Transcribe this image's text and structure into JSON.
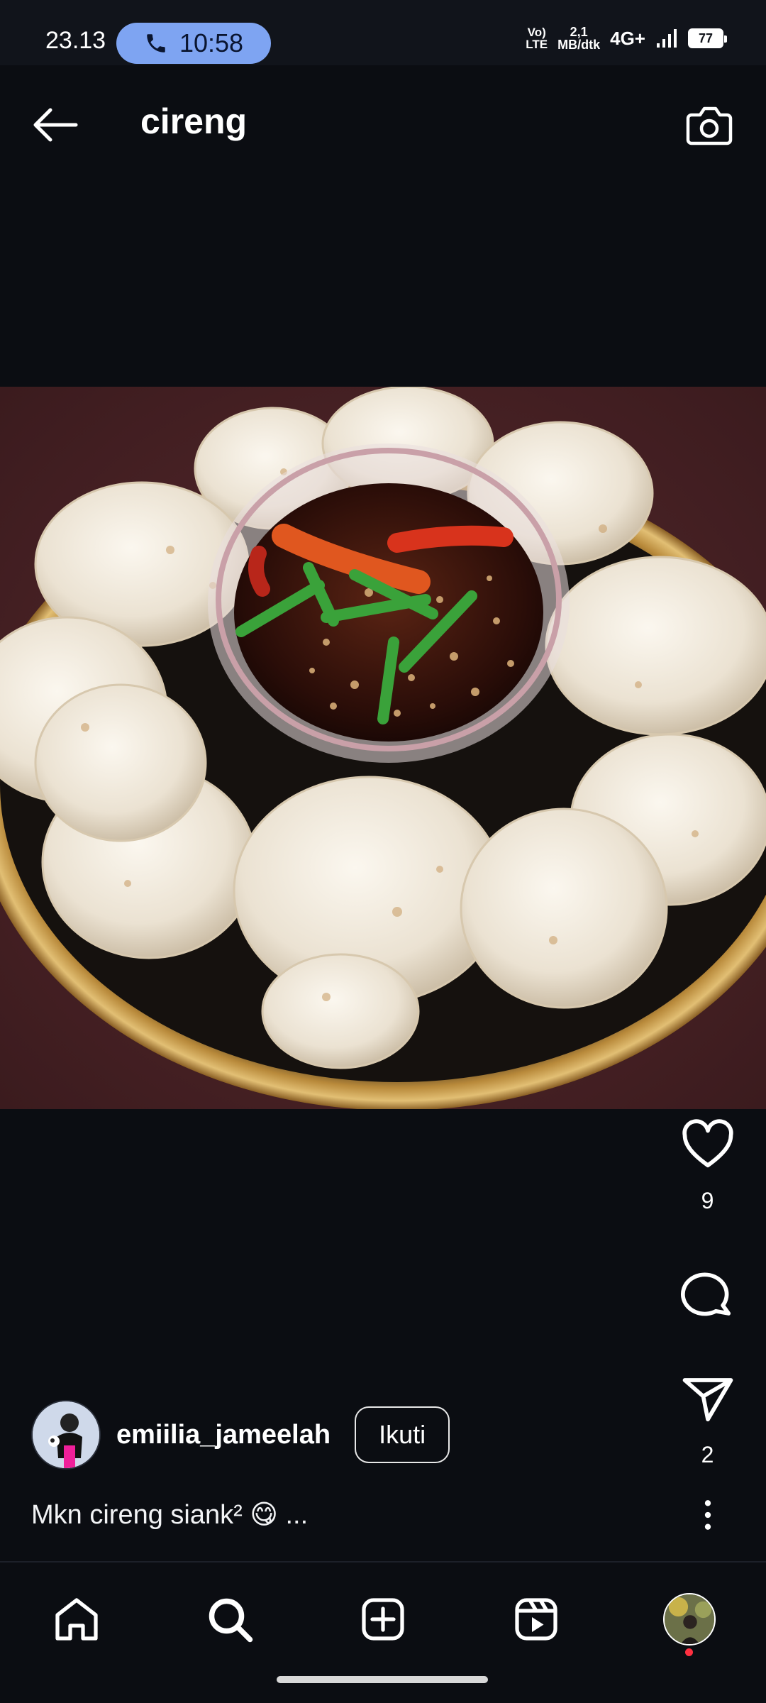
{
  "status_bar": {
    "time": "23.13",
    "call_duration": "10:58",
    "volte_line1": "Vo)",
    "volte_line2": "LTE",
    "speed_line1": "2,1",
    "speed_line2": "MB/dtk",
    "network": "4G+",
    "battery": "77"
  },
  "header": {
    "title": "cireng",
    "back_icon": "arrow-left-icon",
    "camera_icon": "camera-icon"
  },
  "post": {
    "image_description_icon": "food-photo",
    "likes": "9",
    "shares": "2",
    "author": "emiilia_jameelah",
    "follow_label": "Ikuti",
    "caption": "Mkn cireng siank² 😋 ..."
  },
  "nav": {
    "items": [
      "home-icon",
      "search-icon",
      "create-icon",
      "reels-icon",
      "profile-avatar"
    ]
  },
  "colors": {
    "background": "#0b0d12",
    "call_pill": "#7ea4f2",
    "notification_dot": "#ff3040"
  }
}
